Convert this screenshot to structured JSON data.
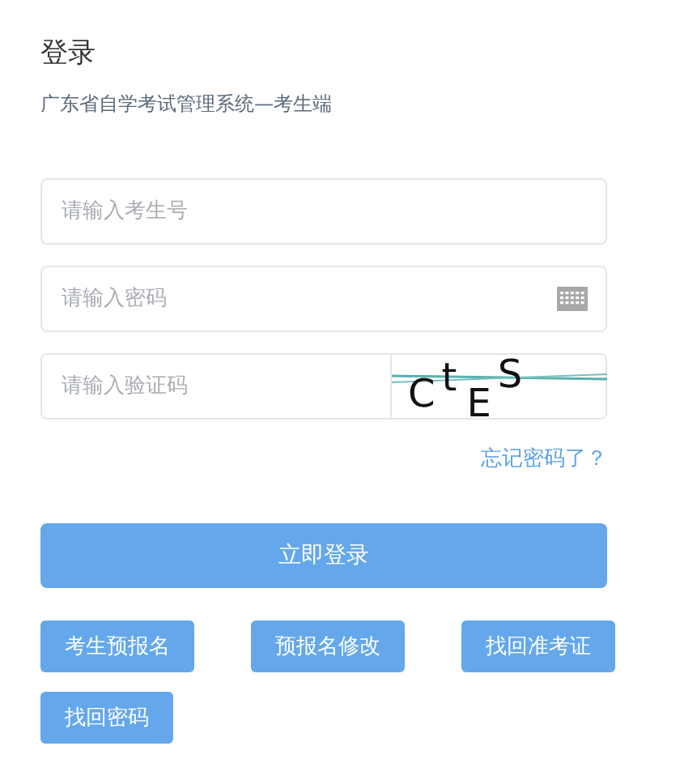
{
  "title": "登录",
  "subtitle": "广东省自学考试管理系统—考生端",
  "fields": [
    {
      "kind": "text",
      "placeholder": "请输入考生号"
    },
    {
      "kind": "password",
      "placeholder": "请输入密码"
    },
    {
      "kind": "captcha",
      "placeholder": "请输入验证码"
    }
  ],
  "captcha_chars": [
    "C",
    "t",
    "E",
    "S"
  ],
  "forgot_link": "忘记密码了？",
  "login_button": "立即登录",
  "buttons": [
    "考生预报名",
    "预报名修改",
    "找回准考证",
    "找回密码"
  ]
}
